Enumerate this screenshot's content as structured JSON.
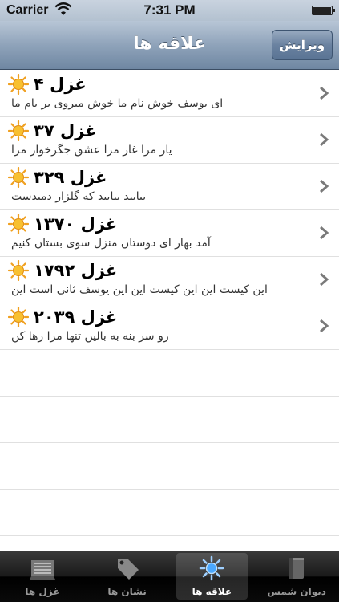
{
  "status_bar": {
    "carrier": "Carrier",
    "time": "7:31 PM"
  },
  "nav": {
    "title": "علاقه ها",
    "edit_label": "ویرایش"
  },
  "rows": [
    {
      "title": "غزل ۴",
      "subtitle": "ای یوسف خوش نام ما خوش میروی بر بام ما"
    },
    {
      "title": "غزل ۳۷",
      "subtitle": "یار مرا غار مرا عشق جگرخوار مرا"
    },
    {
      "title": "غزل ۳۲۹",
      "subtitle": "بیایید بیایید که گلزار دمیدست"
    },
    {
      "title": "غزل ۱۳۷۰",
      "subtitle": "آمد بهار ای دوستان منزل سوی بستان کنیم"
    },
    {
      "title": "غزل ۱۷۹۲",
      "subtitle": "این کیست این این کیست این این یوسف ثانی است این"
    },
    {
      "title": "غزل ۲۰۳۹",
      "subtitle": "رو سر بنه به بالین تنها مرا رها کن"
    }
  ],
  "tabs": [
    {
      "label": "غزل ها",
      "icon": "book-list-icon",
      "selected": false
    },
    {
      "label": "نشان ها",
      "icon": "tag-icon",
      "selected": false
    },
    {
      "label": "علاقه ها",
      "icon": "sun-icon",
      "selected": true
    },
    {
      "label": "دیوان شمس",
      "icon": "book-icon",
      "selected": false
    }
  ],
  "colors": {
    "nav_top": "#b8c6d6",
    "nav_bottom": "#6f87a2",
    "sun": "#f5a623",
    "tab_bar": "#111111"
  }
}
